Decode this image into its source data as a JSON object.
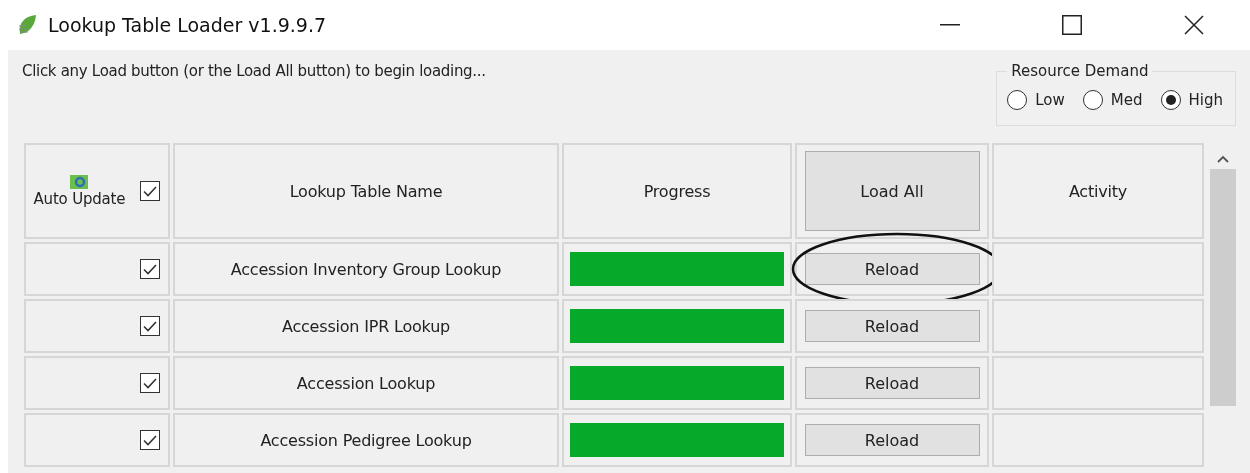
{
  "window": {
    "title": "Lookup Table Loader v1.9.9.7"
  },
  "instruction": "Click any Load button (or the Load All button) to begin loading...",
  "resource_demand": {
    "title": "Resource Demand",
    "options": [
      {
        "label": "Low",
        "selected": false
      },
      {
        "label": "Med",
        "selected": false
      },
      {
        "label": "High",
        "selected": true
      }
    ]
  },
  "table": {
    "header": {
      "auto_update": "Auto Update",
      "auto_update_checked": true,
      "name": "Lookup Table Name",
      "progress": "Progress",
      "load_all": "Load All",
      "activity": "Activity"
    },
    "rows": [
      {
        "checked": true,
        "name": "Accession Inventory Group Lookup",
        "level": 1,
        "button": "Reload",
        "highlighted": true
      },
      {
        "checked": true,
        "name": "Accession IPR Lookup",
        "level": 1,
        "button": "Reload",
        "highlighted": false
      },
      {
        "checked": true,
        "name": "Accession Lookup",
        "level": 1,
        "button": "Reload",
        "highlighted": false
      },
      {
        "checked": true,
        "name": "Accession Pedigree Lookup",
        "level": 1,
        "button": "Reload",
        "highlighted": false
      }
    ]
  }
}
